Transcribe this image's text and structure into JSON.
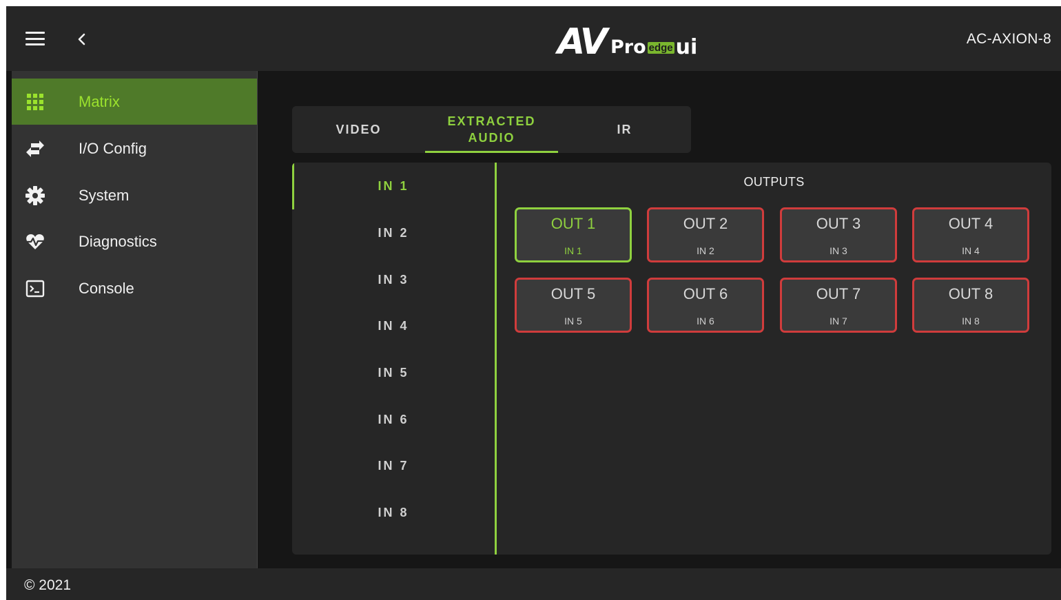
{
  "header": {
    "logo": {
      "av": "AV",
      "pro": "Pro",
      "edge": "edge",
      "ui": "ui"
    },
    "model": "AC-AXION-8",
    "icons": [
      "hamburger-menu-icon",
      "chevron-left-icon"
    ]
  },
  "sidebar": {
    "items": [
      {
        "label": "Matrix",
        "icon": "grid-icon",
        "active": true
      },
      {
        "label": "I/O Config",
        "icon": "swap-arrows-icon",
        "active": false
      },
      {
        "label": "System",
        "icon": "gear-icon",
        "active": false
      },
      {
        "label": "Diagnostics",
        "icon": "heartbeat-icon",
        "active": false
      },
      {
        "label": "Console",
        "icon": "terminal-icon",
        "active": false
      }
    ]
  },
  "tabs": [
    {
      "label": "VIDEO",
      "active": false
    },
    {
      "label": "EXTRACTED AUDIO",
      "active": true
    },
    {
      "label": "IR",
      "active": false
    }
  ],
  "inputs": [
    "IN 1",
    "IN 2",
    "IN 3",
    "IN 4",
    "IN 5",
    "IN 6",
    "IN 7",
    "IN 8"
  ],
  "selected_input": "IN 1",
  "outputs_title": "OUTPUTS",
  "outputs": [
    {
      "name": "OUT 1",
      "source": "IN 1",
      "state": "active"
    },
    {
      "name": "OUT 2",
      "source": "IN 2",
      "state": "inactive"
    },
    {
      "name": "OUT 3",
      "source": "IN 3",
      "state": "inactive"
    },
    {
      "name": "OUT 4",
      "source": "IN 4",
      "state": "inactive"
    },
    {
      "name": "OUT 5",
      "source": "IN 5",
      "state": "inactive"
    },
    {
      "name": "OUT 6",
      "source": "IN 6",
      "state": "inactive"
    },
    {
      "name": "OUT 7",
      "source": "IN 7",
      "state": "inactive"
    },
    {
      "name": "OUT 8",
      "source": "IN 8",
      "state": "inactive"
    }
  ],
  "footer": {
    "copyright": "© 2021"
  },
  "colors": {
    "accent": "#8fd13f",
    "active_nav_bg": "#4f7a29",
    "inactive_border": "#d03c3c",
    "background": "#161616"
  }
}
